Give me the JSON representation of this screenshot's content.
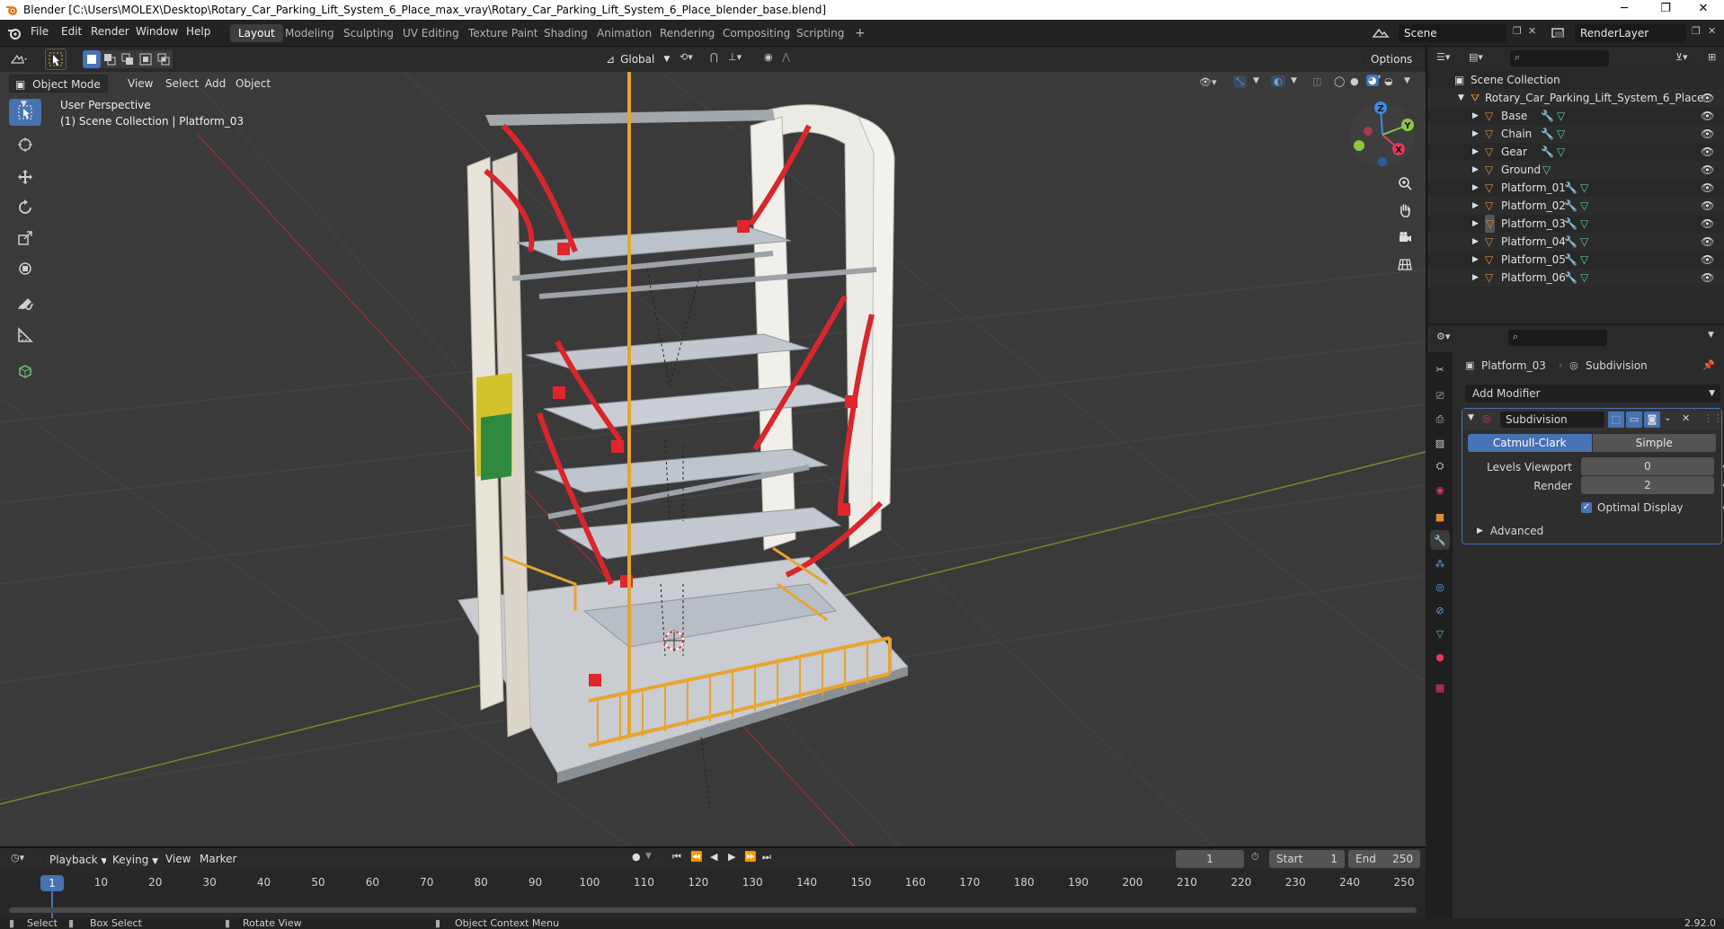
{
  "window": {
    "title": "Blender [C:\\Users\\MOLEX\\Desktop\\Rotary_Car_Parking_Lift_System_6_Place_max_vray\\Rotary_Car_Parking_Lift_System_6_Place_blender_base.blend]",
    "minimize": "─",
    "maximize": "❐",
    "close": "✕"
  },
  "menu": [
    "File",
    "Edit",
    "Render",
    "Window",
    "Help"
  ],
  "workspaces": [
    "Layout",
    "Modeling",
    "Sculpting",
    "UV Editing",
    "Texture Paint",
    "Shading",
    "Animation",
    "Rendering",
    "Compositing",
    "Scripting"
  ],
  "active_workspace": "Layout",
  "add_workspace": "+",
  "scene": {
    "scene_name": "Scene",
    "layer_name": "RenderLayer"
  },
  "viewport": {
    "mode": "Object Mode",
    "menus": [
      "View",
      "Select",
      "Add",
      "Object"
    ],
    "transform_orientation": "Global",
    "options_label": "Options",
    "overlay_title": "User Perspective",
    "overlay_subtitle": "(1) Scene Collection | Platform_03",
    "gizmo": {
      "z": "Z",
      "y": "Y",
      "x": "X"
    }
  },
  "outliner": {
    "search_placeholder": "",
    "root": "Scene Collection",
    "collection": "Rotary_Car_Parking_Lift_System_6_Place",
    "objects": [
      "Base",
      "Chain",
      "Gear",
      "Ground",
      "Platform_01",
      "Platform_02",
      "Platform_03",
      "Platform_04",
      "Platform_05",
      "Platform_06"
    ],
    "active_object": "Platform_03"
  },
  "properties": {
    "object_name": "Platform_03",
    "modifier_breadcrumb": "Subdivision",
    "add_modifier": "Add Modifier",
    "modifier": {
      "name": "Subdivision",
      "algo_options": [
        "Catmull-Clark",
        "Simple"
      ],
      "algo_selected": "Catmull-Clark",
      "levels_viewport_label": "Levels Viewport",
      "levels_viewport": "0",
      "render_label": "Render",
      "render": "2",
      "optimal_display_label": "Optimal Display",
      "optimal_display": true,
      "advanced_label": "Advanced"
    }
  },
  "timeline": {
    "menus": [
      "Playback",
      "Keying",
      "View",
      "Marker"
    ],
    "current_frame": "1",
    "start_label": "Start",
    "start": "1",
    "end_label": "End",
    "end": "250",
    "ticks": [
      "1",
      "10",
      "20",
      "30",
      "40",
      "50",
      "60",
      "70",
      "80",
      "90",
      "100",
      "110",
      "120",
      "130",
      "140",
      "150",
      "160",
      "170",
      "180",
      "190",
      "200",
      "210",
      "220",
      "230",
      "240",
      "250"
    ]
  },
  "status": {
    "select": "Select",
    "box_select": "Box Select",
    "rotate_view": "Rotate View",
    "context_menu": "Object Context Menu",
    "version": "2.92.0"
  },
  "colors": {
    "accent": "#4772b3",
    "object_icon": "#e38d3a",
    "modifier_icon": "#6da7e8",
    "mesh_icon": "#5fd0a0",
    "x_axis": "#e2395a",
    "y_axis": "#8ac83d",
    "z_axis": "#3b8be8"
  }
}
